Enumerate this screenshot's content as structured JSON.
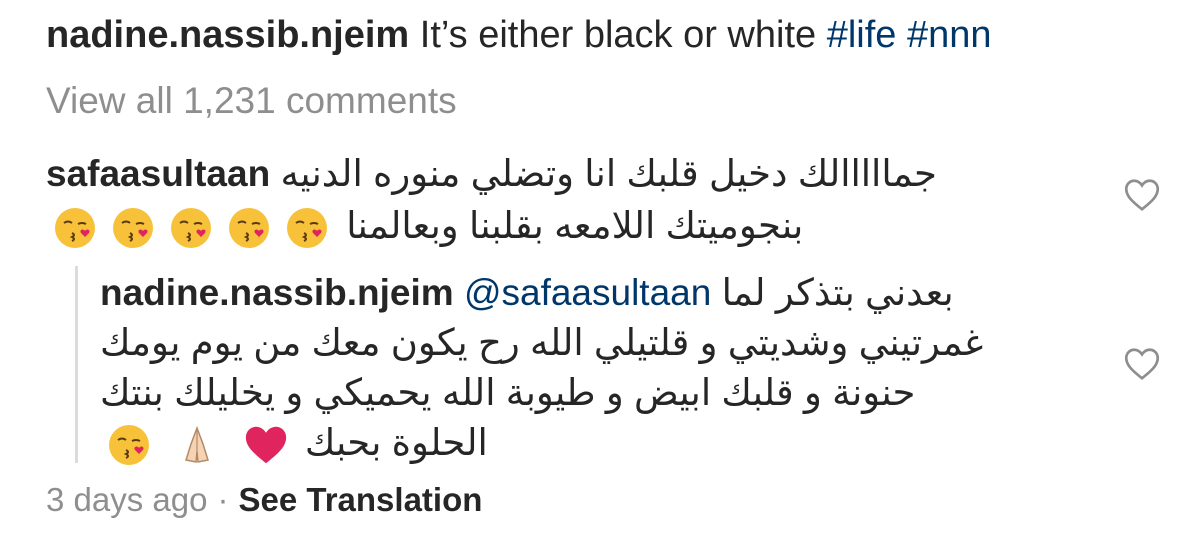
{
  "caption": {
    "username": "nadine.nassib.njeim",
    "text": "It’s either black or white",
    "hashtags": [
      "#life",
      "#nnn"
    ]
  },
  "view_all_comments": "View all 1,231 comments",
  "comment": {
    "username": "safaasultaan",
    "text_line1": "جمااااالك دخيل قلبك انا وتضلي منوره الدنيه",
    "text_line2": "بنجوميتك اللامعه بقلبنا وبعالمنا",
    "emoji_count": 5,
    "emoji_icon": "kissing-face-heart-icon"
  },
  "reply": {
    "username": "nadine.nassib.njeim",
    "mention": "@safaasultaan",
    "text_line1": "بعدني بتذكر لما",
    "text_line2": "غمرتيني وشديتي و قلتيلي الله رح يكون معك من يوم يومك",
    "text_line3": "حنونة و قلبك ابيض و طيوبة الله يحميكي و يخليلك بنتك",
    "text_line4": "الحلوة بحبك",
    "emojis": [
      "red-heart-icon",
      "praying-hands-icon",
      "kissing-face-heart-icon"
    ]
  },
  "footer": {
    "time": "3 days ago",
    "separator": "·",
    "see_translation": "See Translation"
  },
  "colors": {
    "text": "#262626",
    "secondary": "#8e8e8e",
    "link": "#00376b",
    "heart_outline": "#8e8e8e"
  }
}
